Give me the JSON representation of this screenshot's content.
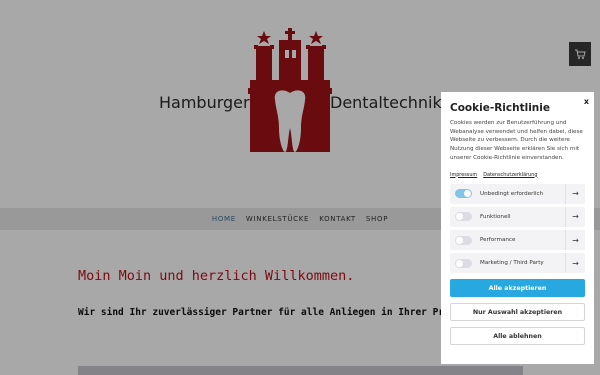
{
  "logo": {
    "left_text": "Hamburger",
    "right_text": "Dentaltechnik",
    "icon": "hamburg-castle-tooth-logo"
  },
  "cart": {
    "icon": "cart-icon"
  },
  "nav": {
    "items": [
      {
        "label": "HOME",
        "active": true
      },
      {
        "label": "WINKELSTÜCKE",
        "active": false
      },
      {
        "label": "KONTAKT",
        "active": false
      },
      {
        "label": "SHOP",
        "active": false
      }
    ]
  },
  "main": {
    "headline": "Moin Moin und herzlich Willkommen.",
    "subline": "Wir sind Ihr zuverlässiger Partner für alle Anliegen in Ihrer Praxis."
  },
  "cookie": {
    "title": "Cookie-Richtlinie",
    "close": "x",
    "text": "Cookies werden zur Benutzerführung und Webanalyse verwendet und helfen dabei, diese Webseite zu verbessern. Durch die weitere Nutzung dieser Webseite erklären Sie sich mit unserer Cookie-Richtlinie einverstanden.",
    "links": [
      "Impressum",
      "Datenschutzerklärung"
    ],
    "toggles": [
      {
        "label": "Unbedingt erforderlich",
        "on": true
      },
      {
        "label": "Funktionell",
        "on": false
      },
      {
        "label": "Performance",
        "on": false
      },
      {
        "label": "Marketing / Third Party",
        "on": false
      }
    ],
    "arrow": "→",
    "buttons": {
      "accept_all": "Alle akzeptieren",
      "accept_selection": "Nur Auswahl akzeptieren",
      "reject_all": "Alle ablehnen"
    }
  },
  "colors": {
    "brand_red": "#c0121a",
    "accent_blue": "#28a8e0",
    "toggle_on": "#7fc6e8"
  }
}
